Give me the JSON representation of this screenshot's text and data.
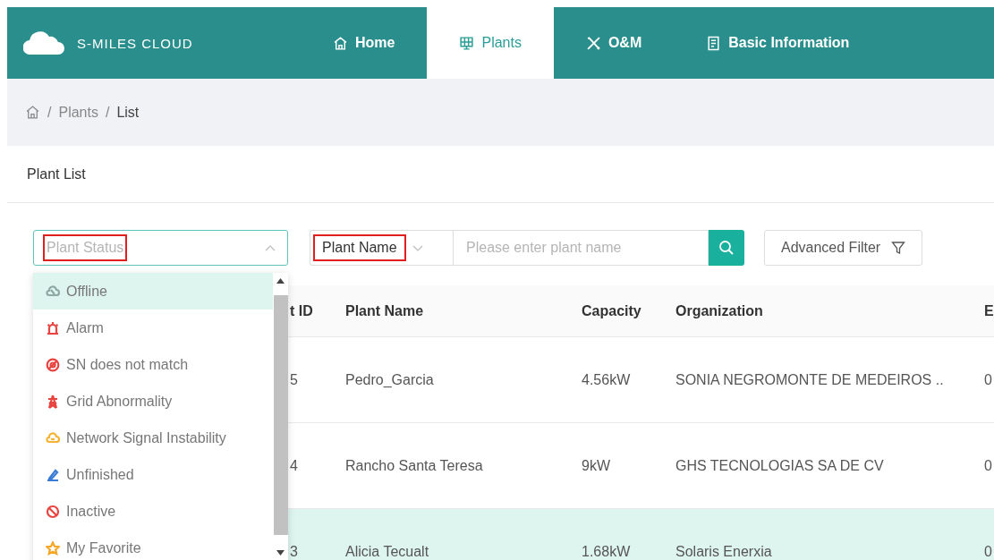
{
  "header": {
    "logo_text": "S-MILES CLOUD",
    "nav": [
      {
        "label": "Home",
        "kind": "home",
        "selected": false
      },
      {
        "label": "Plants",
        "kind": "plants",
        "selected": true
      },
      {
        "label": "O&M",
        "kind": "tools",
        "selected": false
      },
      {
        "label": "Basic Information",
        "kind": "info",
        "selected": false
      }
    ]
  },
  "breadcrumb": {
    "separator": "/",
    "items": [
      "Plants",
      "List"
    ]
  },
  "card_title": "Plant List",
  "filters": {
    "status": {
      "placeholder": "Plant Status",
      "highlighted": true,
      "expanded": true
    },
    "name_type": {
      "value": "Plant Name",
      "highlighted": true
    },
    "name_search": {
      "placeholder": "Please enter plant name"
    },
    "advanced_filter": "Advanced Filter"
  },
  "status_options": [
    {
      "label": "Offline",
      "kind": "offline",
      "color": "#8fa9a5",
      "selected": true
    },
    {
      "label": "Alarm",
      "kind": "alarm",
      "color": "#e8433f",
      "selected": false
    },
    {
      "label": "SN does not match",
      "kind": "mismatch",
      "color": "#e8433f",
      "selected": false
    },
    {
      "label": "Grid Abnormality",
      "kind": "grid",
      "color": "#e8433f",
      "selected": false
    },
    {
      "label": "Network Signal Instability",
      "kind": "network",
      "color": "#f5b335",
      "selected": false
    },
    {
      "label": "Unfinished",
      "kind": "unfinished",
      "color": "#3a7bd5",
      "selected": false
    },
    {
      "label": "Inactive",
      "kind": "inactive",
      "color": "#e8433f",
      "selected": false
    },
    {
      "label": "My Favorite",
      "kind": "favorite",
      "color": "#f5a623",
      "selected": false
    }
  ],
  "table": {
    "columns": [
      "t ID",
      "Plant Name",
      "Capacity",
      "Organization",
      "E"
    ],
    "rows": [
      {
        "cells": [
          "5",
          "Pedro_Garcia",
          "4.56kW",
          "SONIA NEGROMONTE DE MEDEIROS ..",
          "0"
        ],
        "selected": false
      },
      {
        "cells": [
          "4",
          "Rancho Santa Teresa",
          "9kW",
          "GHS TECNOLOGIAS SA DE CV",
          "0"
        ],
        "selected": false
      },
      {
        "cells": [
          "3",
          "Alicia Tecualt",
          "1.68kW",
          "Solaris Enerxia",
          "0"
        ],
        "selected": true
      }
    ]
  }
}
